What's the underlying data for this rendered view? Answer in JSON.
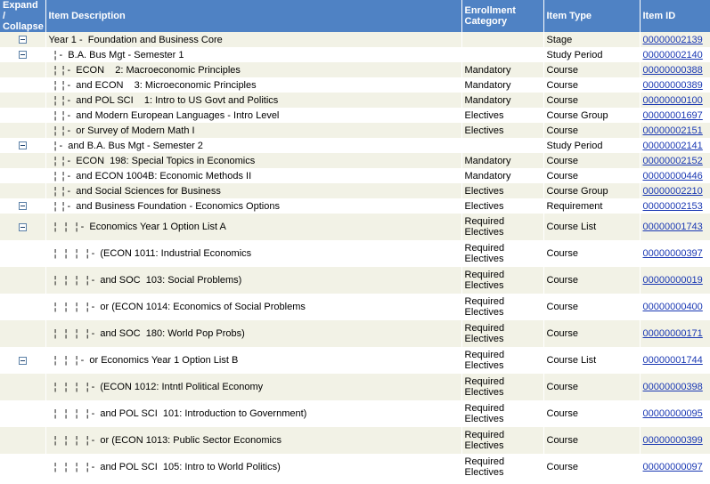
{
  "header": {
    "expand": "Expand /\nCollapse",
    "desc": "Item Description",
    "enroll": "Enrollment Category",
    "type": "Item Type",
    "id": "Item ID"
  },
  "rows": [
    {
      "toggle": true,
      "desc": "Year 1 -  Foundation and Business Core",
      "enroll": "",
      "type": "Stage",
      "id": "00000002139"
    },
    {
      "toggle": true,
      "desc": "  ¦ -  B.A. Bus Mgt - Semester 1",
      "enroll": "",
      "type": "Study Period",
      "id": "00000002140"
    },
    {
      "toggle": false,
      "desc": "  ¦  ¦ -  ECON    2: Macroeconomic Principles",
      "enroll": "Mandatory",
      "type": "Course",
      "id": "00000000388"
    },
    {
      "toggle": false,
      "desc": "  ¦  ¦ -  and ECON    3: Microeconomic Principles",
      "enroll": "Mandatory",
      "type": "Course",
      "id": "00000000389"
    },
    {
      "toggle": false,
      "desc": "  ¦  ¦ -  and POL SCI    1: Intro to US Govt and Politics",
      "enroll": "Mandatory",
      "type": "Course",
      "id": "00000000100"
    },
    {
      "toggle": false,
      "desc": "  ¦  ¦ -  and Modern European Languages - Intro Level",
      "enroll": "Electives",
      "type": "Course Group",
      "id": "00000001697"
    },
    {
      "toggle": false,
      "desc": "  ¦  ¦ -  or Survey of Modern Math I",
      "enroll": "Electives",
      "type": "Course",
      "id": "00000002151"
    },
    {
      "toggle": true,
      "desc": "  ¦ -  and B.A. Bus Mgt - Semester 2",
      "enroll": "",
      "type": "Study Period",
      "id": "00000002141"
    },
    {
      "toggle": false,
      "desc": "  ¦  ¦ -  ECON  198: Special Topics in Economics",
      "enroll": "Mandatory",
      "type": "Course",
      "id": "00000002152"
    },
    {
      "toggle": false,
      "desc": "  ¦  ¦ -  and ECON 1004B: Economic Methods II",
      "enroll": "Mandatory",
      "type": "Course",
      "id": "00000000446"
    },
    {
      "toggle": false,
      "desc": "  ¦  ¦ -  and Social Sciences for Business",
      "enroll": "Electives",
      "type": "Course Group",
      "id": "00000002210"
    },
    {
      "toggle": true,
      "desc": "  ¦  ¦ -  and Business Foundation - Economics Options",
      "enroll": "Electives",
      "type": "Requirement",
      "id": "00000002153"
    },
    {
      "toggle": true,
      "desc": "  ¦   ¦   ¦ -  Economics Year 1 Option List A",
      "enroll": "Required\nElectives",
      "type": "Course List",
      "id": "00000001743"
    },
    {
      "toggle": false,
      "desc": "  ¦   ¦   ¦   ¦ -  (ECON 1011: Industrial Economics",
      "enroll": "Required\nElectives",
      "type": "Course",
      "id": "00000000397"
    },
    {
      "toggle": false,
      "desc": "  ¦   ¦   ¦   ¦ -  and SOC  103: Social Problems)",
      "enroll": "Required\nElectives",
      "type": "Course",
      "id": "00000000019"
    },
    {
      "toggle": false,
      "desc": "  ¦   ¦   ¦   ¦ -  or (ECON 1014: Economics of Social Problems",
      "enroll": "Required\nElectives",
      "type": "Course",
      "id": "00000000400"
    },
    {
      "toggle": false,
      "desc": "  ¦   ¦   ¦   ¦ -  and SOC  180: World Pop Probs)",
      "enroll": "Required\nElectives",
      "type": "Course",
      "id": "00000000171"
    },
    {
      "toggle": true,
      "desc": "  ¦   ¦   ¦ -  or Economics Year 1 Option List B",
      "enroll": "Required\nElectives",
      "type": "Course List",
      "id": "00000001744"
    },
    {
      "toggle": false,
      "desc": "  ¦   ¦   ¦   ¦ -  (ECON 1012: Intntl Political Economy",
      "enroll": "Required\nElectives",
      "type": "Course",
      "id": "00000000398"
    },
    {
      "toggle": false,
      "desc": "  ¦   ¦   ¦   ¦ -  and POL SCI  101: Introduction to Government)",
      "enroll": "Required\nElectives",
      "type": "Course",
      "id": "00000000095"
    },
    {
      "toggle": false,
      "desc": "  ¦   ¦   ¦   ¦ -  or (ECON 1013: Public Sector Economics",
      "enroll": "Required\nElectives",
      "type": "Course",
      "id": "00000000399"
    },
    {
      "toggle": false,
      "desc": "  ¦   ¦   ¦   ¦ -  and POL SCI  105: Intro to World Politics)",
      "enroll": "Required\nElectives",
      "type": "Course",
      "id": "00000000097"
    }
  ]
}
